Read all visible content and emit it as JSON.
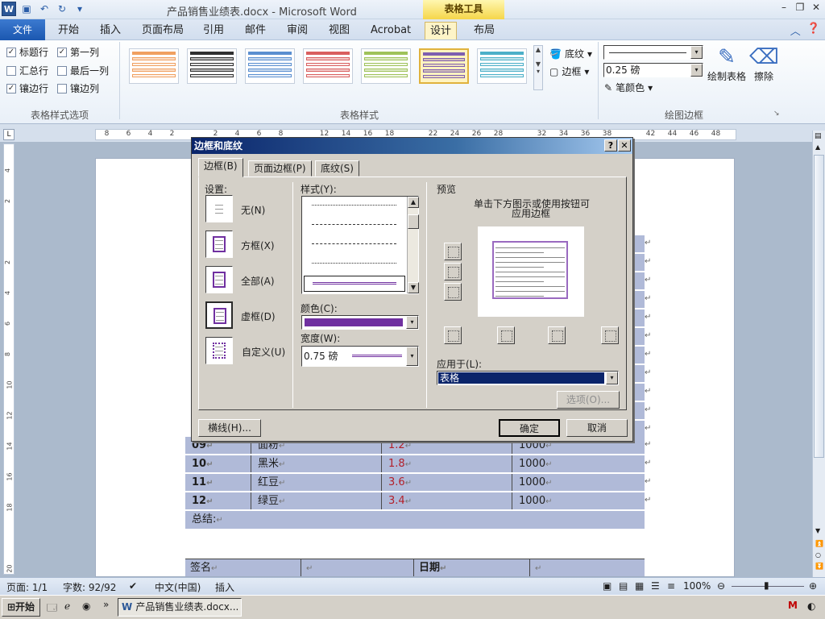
{
  "titlebar": {
    "title": "产品销售业绩表.docx - Microsoft Word",
    "context_tab": "表格工具",
    "app_logo": "W",
    "undo_label": "↶",
    "redo_label": "↻"
  },
  "tabs": [
    "文件",
    "开始",
    "插入",
    "页面布局",
    "引用",
    "邮件",
    "审阅",
    "视图",
    "Acrobat",
    "设计",
    "布局"
  ],
  "ribbon": {
    "style_options": {
      "label": "表格样式选项",
      "items": [
        {
          "label": "标题行",
          "checked": true
        },
        {
          "label": "第一列",
          "checked": true
        },
        {
          "label": "汇总行",
          "checked": false
        },
        {
          "label": "最后一列",
          "checked": false
        },
        {
          "label": "镶边行",
          "checked": true
        },
        {
          "label": "镶边列",
          "checked": false
        }
      ]
    },
    "table_styles": {
      "label": "表格样式",
      "colors": [
        "#f0a060",
        "#303030",
        "#5b8fd0",
        "#d95f5f",
        "#9fc25a",
        "#7d5fb0",
        "#4cb0c8"
      ],
      "shading_label": "底纹",
      "border_label": "边框"
    },
    "draw_borders": {
      "label": "绘图边框",
      "weight": "0.25 磅",
      "pen_color_label": "笔颜色",
      "draw_table_label": "绘制表格",
      "eraser_label": "擦除"
    }
  },
  "ruler": {
    "ticks": [
      "8",
      "6",
      "4",
      "2",
      "",
      "2",
      "4",
      "6",
      "8",
      "",
      "12",
      "14",
      "16",
      "18",
      "",
      "22",
      "24",
      "26",
      "28",
      "",
      "32",
      "34",
      "36",
      "38",
      "",
      "42",
      "44",
      "46",
      "48"
    ],
    "vticks": [
      "4",
      "2",
      "",
      "2",
      "4",
      "6",
      "8",
      "10",
      "12",
      "14",
      "16",
      "18",
      "",
      "20"
    ]
  },
  "document_rows": [
    {
      "no": "09",
      "name": "面粉",
      "value": "1.2",
      "target": "1000"
    },
    {
      "no": "10",
      "name": "黑米",
      "value": "1.8",
      "target": "1000"
    },
    {
      "no": "11",
      "name": "红豆",
      "value": "3.6",
      "target": "1000"
    },
    {
      "no": "12",
      "name": "绿豆",
      "value": "3.4",
      "target": "1000"
    }
  ],
  "summary_label": "总结:",
  "sign": {
    "sign_label": "签名",
    "date_label": "日期"
  },
  "para_mark": "↵",
  "dialog": {
    "title": "边框和底纹",
    "tabs": [
      "边框(B)",
      "页面边框(P)",
      "底纹(S)"
    ],
    "setting_label": "设置:",
    "settings": [
      "无(N)",
      "方框(X)",
      "全部(A)",
      "虚框(D)",
      "自定义(U)"
    ],
    "style_label": "样式(Y):",
    "color_label": "颜色(C):",
    "color_value": "#7030a0",
    "width_label": "宽度(W):",
    "width_value": "0.75 磅",
    "preview_label": "预览",
    "preview_hint_1": "单击下方图示或使用按钮可",
    "preview_hint_2": "应用边框",
    "apply_to_label": "应用于(L):",
    "apply_to_value": "表格",
    "options_button": "选项(O)...",
    "horizontal_line_button": "横线(H)...",
    "ok_button": "确定",
    "cancel_button": "取消"
  },
  "statusbar": {
    "page": "页面: 1/1",
    "words": "字数: 92/92",
    "language": "中文(中国)",
    "mode": "插入",
    "zoom": "100%"
  },
  "taskbar": {
    "start": "开始",
    "task": "产品销售业绩表.docx..."
  }
}
